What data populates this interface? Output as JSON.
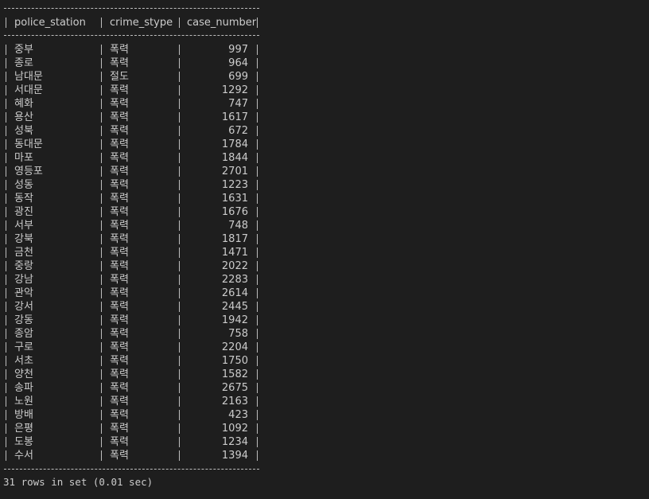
{
  "columns": [
    "police_station",
    "crime_stype",
    "case_number"
  ],
  "rows": [
    [
      "중부",
      "폭력",
      "997"
    ],
    [
      "종로",
      "폭력",
      "964"
    ],
    [
      "남대문",
      "절도",
      "699"
    ],
    [
      "서대문",
      "폭력",
      "1292"
    ],
    [
      "혜화",
      "폭력",
      "747"
    ],
    [
      "용산",
      "폭력",
      "1617"
    ],
    [
      "성북",
      "폭력",
      "672"
    ],
    [
      "동대문",
      "폭력",
      "1784"
    ],
    [
      "마포",
      "폭력",
      "1844"
    ],
    [
      "영등포",
      "폭력",
      "2701"
    ],
    [
      "성동",
      "폭력",
      "1223"
    ],
    [
      "동작",
      "폭력",
      "1631"
    ],
    [
      "광진",
      "폭력",
      "1676"
    ],
    [
      "서부",
      "폭력",
      "748"
    ],
    [
      "강북",
      "폭력",
      "1817"
    ],
    [
      "금천",
      "폭력",
      "1471"
    ],
    [
      "중랑",
      "폭력",
      "2022"
    ],
    [
      "강남",
      "폭력",
      "2283"
    ],
    [
      "관악",
      "폭력",
      "2614"
    ],
    [
      "강서",
      "폭력",
      "2445"
    ],
    [
      "강동",
      "폭력",
      "1942"
    ],
    [
      "종암",
      "폭력",
      "758"
    ],
    [
      "구로",
      "폭력",
      "2204"
    ],
    [
      "서초",
      "폭력",
      "1750"
    ],
    [
      "양천",
      "폭력",
      "1582"
    ],
    [
      "송파",
      "폭력",
      "2675"
    ],
    [
      "노원",
      "폭력",
      "2163"
    ],
    [
      "방배",
      "폭력",
      "423"
    ],
    [
      "은평",
      "폭력",
      "1092"
    ],
    [
      "도봉",
      "폭력",
      "1234"
    ],
    [
      "수서",
      "폭력",
      "1394"
    ]
  ],
  "footer": "31 rows in set (0.01 sec)",
  "colors": {
    "background": "#1e1e1e",
    "text": "#cccccc",
    "rule": "#bdbdbd"
  }
}
